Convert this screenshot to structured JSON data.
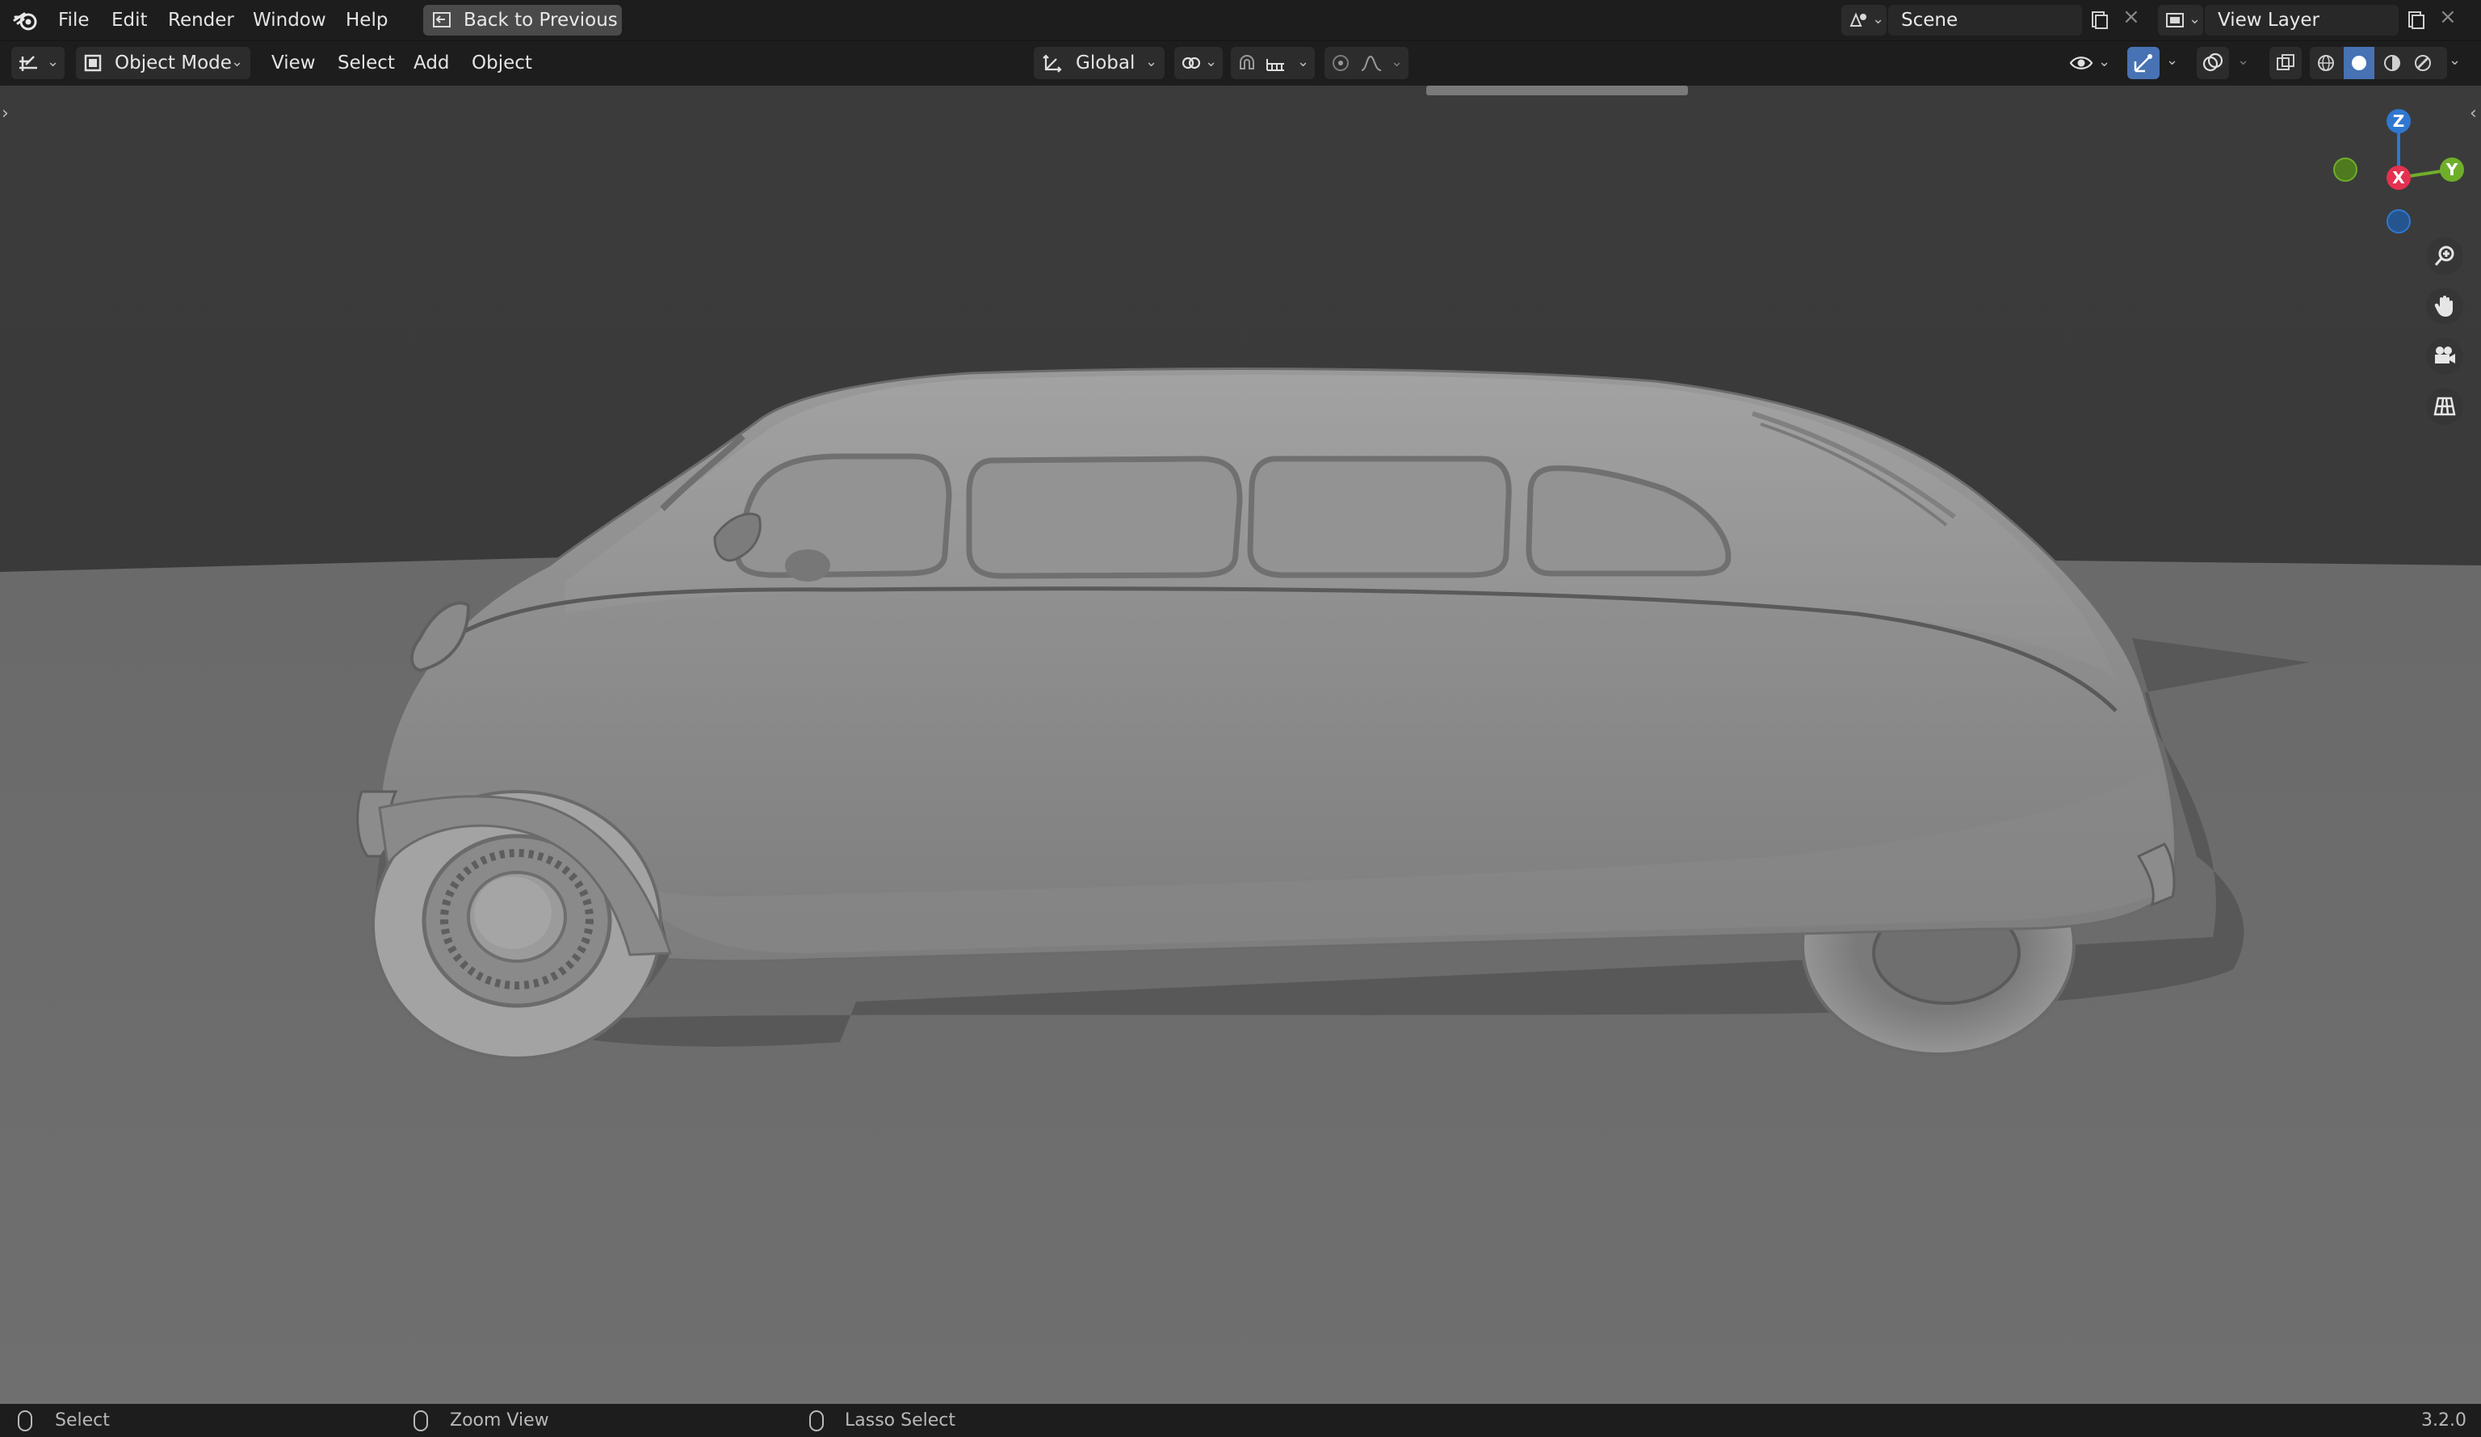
{
  "topbar": {
    "menus": [
      "File",
      "Edit",
      "Render",
      "Window",
      "Help"
    ],
    "back_button": "Back to Previous",
    "scene_name": "Scene",
    "view_layer_name": "View Layer"
  },
  "header": {
    "mode": "Object Mode",
    "menus": [
      "View",
      "Select",
      "Add",
      "Object"
    ],
    "orientation": "Global"
  },
  "gizmo": {
    "axes": {
      "z": "Z",
      "y": "Y",
      "x": "X"
    },
    "colors": {
      "z": "#2f77d0",
      "y": "#6fae2a",
      "x": "#e53150",
      "neg_y": "#4f7a1f",
      "neg_z": "#25558f"
    }
  },
  "viewport": {
    "background_color": "#3b3b3b",
    "floor_color": "#6d6d6d",
    "object": "car model"
  },
  "statusbar": {
    "select": "Select",
    "zoom": "Zoom View",
    "lasso": "Lasso Select",
    "version": "3.2.0"
  }
}
